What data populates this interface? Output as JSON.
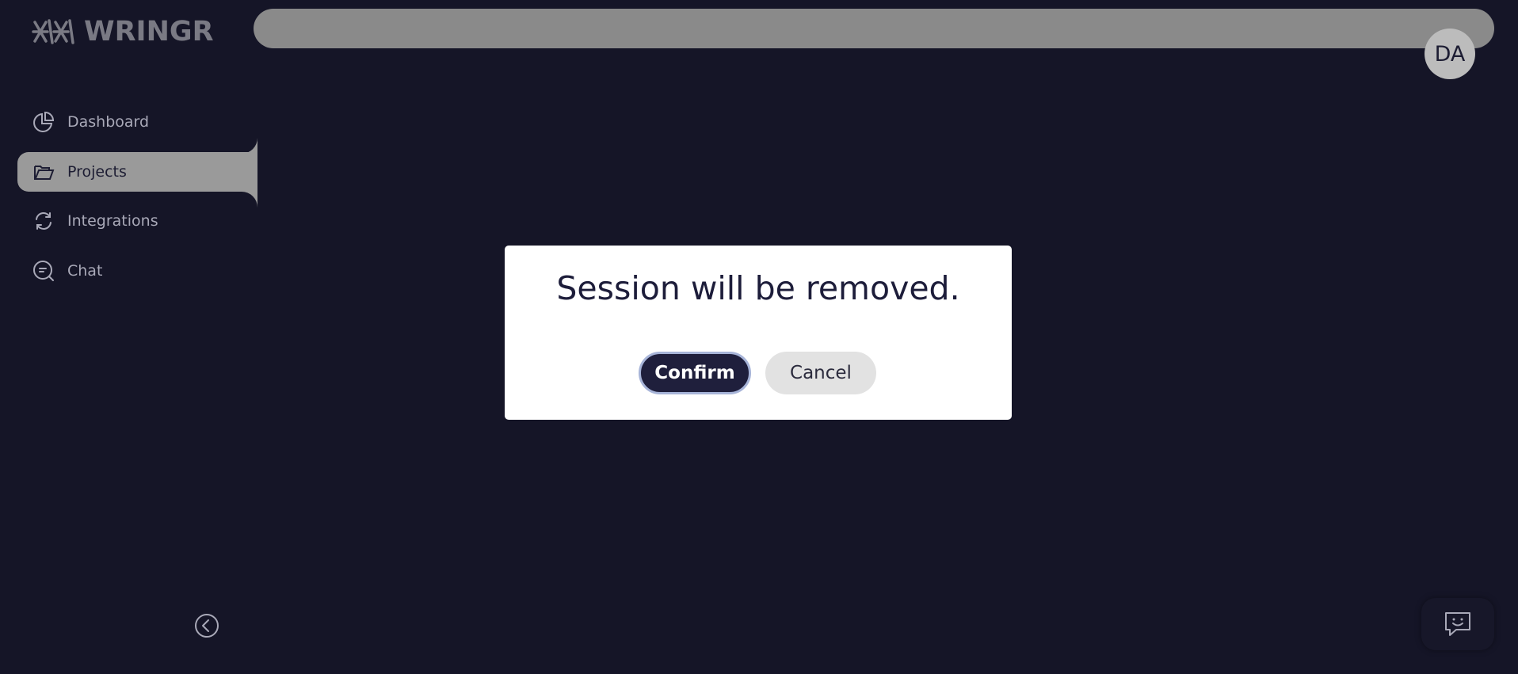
{
  "app": {
    "name": "WRINGR"
  },
  "header": {
    "avatar_initials": "DA"
  },
  "sidebar": {
    "items": [
      {
        "label": "Dashboard",
        "icon": "pie-chart-icon"
      },
      {
        "label": "Projects",
        "icon": "folder-open-icon",
        "active": true
      },
      {
        "label": "Integrations",
        "icon": "refresh-icon"
      },
      {
        "label": "Chat",
        "icon": "chat-search-icon"
      }
    ]
  },
  "modal": {
    "title": "Session will be removed.",
    "confirm_label": "Confirm",
    "cancel_label": "Cancel"
  },
  "colors": {
    "background": "#151527",
    "accent": "#1f1f3c",
    "sidebar_active": "#9a9a9a"
  }
}
